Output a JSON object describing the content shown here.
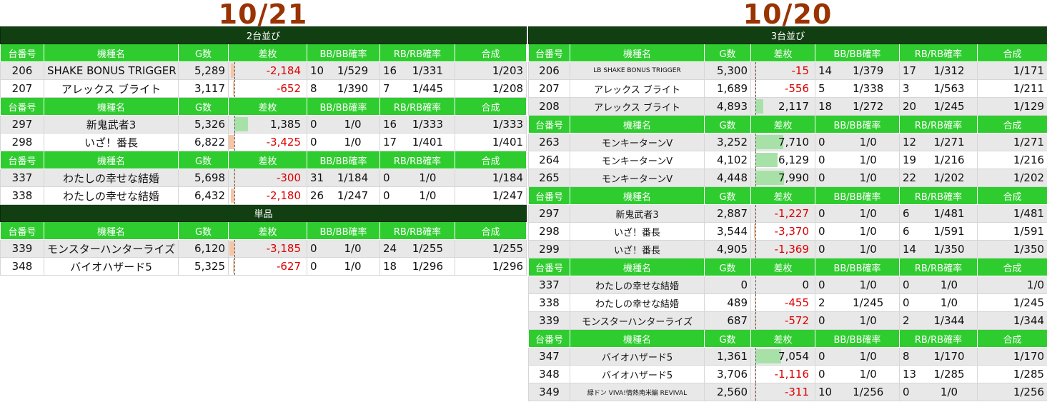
{
  "left": {
    "date": "10/21",
    "axis_pct": 7,
    "headers": [
      "台番号",
      "機種名",
      "G数",
      "差枚",
      "BB/BB確率",
      "RB/RB確率",
      "合成"
    ],
    "groups": [
      {
        "title": "2台並び",
        "blocks": [
          [
            {
              "no": "206",
              "name": "SHAKE BONUS TRIGGER",
              "g": "5,289",
              "diff": "-2,184",
              "diff_num": -2184,
              "bb": "10",
              "bbr": "1/529",
              "rb": "16",
              "rbr": "1/331",
              "total": "1/203"
            },
            {
              "no": "207",
              "name": "アレックス ブライト",
              "g": "3,117",
              "diff": "-652",
              "diff_num": -652,
              "bb": "8",
              "bbr": "1/390",
              "rb": "7",
              "rbr": "1/445",
              "total": "1/208"
            }
          ],
          [
            {
              "no": "297",
              "name": "新鬼武者3",
              "g": "5,326",
              "diff": "1,385",
              "diff_num": 1385,
              "bb": "0",
              "bbr": "1/0",
              "rb": "16",
              "rbr": "1/333",
              "total": "1/333"
            },
            {
              "no": "298",
              "name": "いざ！番長",
              "g": "6,822",
              "diff": "-3,425",
              "diff_num": -3425,
              "bb": "0",
              "bbr": "1/0",
              "rb": "17",
              "rbr": "1/401",
              "total": "1/401"
            }
          ],
          [
            {
              "no": "337",
              "name": "わたしの幸せな結婚",
              "g": "5,698",
              "diff": "-300",
              "diff_num": -300,
              "bb": "31",
              "bbr": "1/184",
              "rb": "0",
              "rbr": "1/0",
              "total": "1/184"
            },
            {
              "no": "338",
              "name": "わたしの幸せな結婚",
              "g": "6,432",
              "diff": "-2,180",
              "diff_num": -2180,
              "bb": "26",
              "bbr": "1/247",
              "rb": "0",
              "rbr": "1/0",
              "total": "1/247"
            }
          ]
        ]
      },
      {
        "title": "単品",
        "blocks": [
          [
            {
              "no": "339",
              "name": "モンスターハンターライズ",
              "g": "6,120",
              "diff": "-3,185",
              "diff_num": -3185,
              "bb": "0",
              "bbr": "1/0",
              "rb": "24",
              "rbr": "1/255",
              "total": "1/255"
            },
            {
              "no": "348",
              "name": "バイオハザード5",
              "g": "5,325",
              "diff": "-627",
              "diff_num": -627,
              "bb": "0",
              "bbr": "1/0",
              "rb": "18",
              "rbr": "1/296",
              "total": "1/296"
            }
          ]
        ]
      }
    ]
  },
  "right": {
    "date": "10/20",
    "axis_pct": 7,
    "headers": [
      "台番号",
      "機種名",
      "G数",
      "差枚",
      "BB/BB確率",
      "RB/RB確率",
      "合成"
    ],
    "groups": [
      {
        "title": "3台並び",
        "blocks": [
          [
            {
              "no": "206",
              "name": "LB SHAKE BONUS TRIGGER",
              "g": "5,300",
              "diff": "-15",
              "diff_num": -15,
              "bb": "14",
              "bbr": "1/379",
              "rb": "17",
              "rbr": "1/312",
              "total": "1/171"
            },
            {
              "no": "207",
              "name": "アレックス ブライト",
              "g": "1,689",
              "diff": "-556",
              "diff_num": -556,
              "bb": "5",
              "bbr": "1/338",
              "rb": "3",
              "rbr": "1/563",
              "total": "1/211"
            },
            {
              "no": "208",
              "name": "アレックス ブライト",
              "g": "4,893",
              "diff": "2,117",
              "diff_num": 2117,
              "bb": "18",
              "bbr": "1/272",
              "rb": "20",
              "rbr": "1/245",
              "total": "1/129"
            }
          ],
          [
            {
              "no": "263",
              "name": "モンキーターンV",
              "g": "3,252",
              "diff": "7,710",
              "diff_num": 7710,
              "bb": "0",
              "bbr": "1/0",
              "rb": "12",
              "rbr": "1/271",
              "total": "1/271"
            },
            {
              "no": "264",
              "name": "モンキーターンV",
              "g": "4,102",
              "diff": "6,129",
              "diff_num": 6129,
              "bb": "0",
              "bbr": "1/0",
              "rb": "19",
              "rbr": "1/216",
              "total": "1/216"
            },
            {
              "no": "265",
              "name": "モンキーターンV",
              "g": "4,448",
              "diff": "7,990",
              "diff_num": 7990,
              "bb": "0",
              "bbr": "1/0",
              "rb": "22",
              "rbr": "1/202",
              "total": "1/202"
            }
          ],
          [
            {
              "no": "297",
              "name": "新鬼武者3",
              "g": "2,887",
              "diff": "-1,227",
              "diff_num": -1227,
              "bb": "0",
              "bbr": "1/0",
              "rb": "6",
              "rbr": "1/481",
              "total": "1/481"
            },
            {
              "no": "298",
              "name": "いざ！番長",
              "g": "3,544",
              "diff": "-3,370",
              "diff_num": -3370,
              "bb": "0",
              "bbr": "1/0",
              "rb": "6",
              "rbr": "1/591",
              "total": "1/591"
            },
            {
              "no": "299",
              "name": "いざ！番長",
              "g": "4,905",
              "diff": "-1,369",
              "diff_num": -1369,
              "bb": "0",
              "bbr": "1/0",
              "rb": "14",
              "rbr": "1/350",
              "total": "1/350"
            }
          ],
          [
            {
              "no": "337",
              "name": "わたしの幸せな結婚",
              "g": "0",
              "diff": "0",
              "diff_num": 0,
              "bb": "0",
              "bbr": "1/0",
              "rb": "0",
              "rbr": "1/0",
              "total": "1/0"
            },
            {
              "no": "338",
              "name": "わたしの幸せな結婚",
              "g": "489",
              "diff": "-455",
              "diff_num": -455,
              "bb": "2",
              "bbr": "1/245",
              "rb": "0",
              "rbr": "1/0",
              "total": "1/245"
            },
            {
              "no": "339",
              "name": "モンスターハンターライズ",
              "g": "687",
              "diff": "-572",
              "diff_num": -572,
              "bb": "0",
              "bbr": "1/0",
              "rb": "2",
              "rbr": "1/344",
              "total": "1/344"
            }
          ],
          [
            {
              "no": "347",
              "name": "バイオハザード5",
              "g": "1,361",
              "diff": "7,054",
              "diff_num": 7054,
              "bb": "0",
              "bbr": "1/0",
              "rb": "8",
              "rbr": "1/170",
              "total": "1/170"
            },
            {
              "no": "348",
              "name": "バイオハザード5",
              "g": "3,706",
              "diff": "-1,116",
              "diff_num": -1116,
              "bb": "0",
              "bbr": "1/0",
              "rb": "13",
              "rbr": "1/285",
              "total": "1/285"
            },
            {
              "no": "349",
              "name": "緑ドン VIVA!情熱南米編 REVIVAL",
              "g": "2,560",
              "diff": "-311",
              "diff_num": -311,
              "bb": "10",
              "bbr": "1/256",
              "rb": "0",
              "rbr": "1/0",
              "total": "1/256"
            }
          ]
        ]
      }
    ]
  }
}
